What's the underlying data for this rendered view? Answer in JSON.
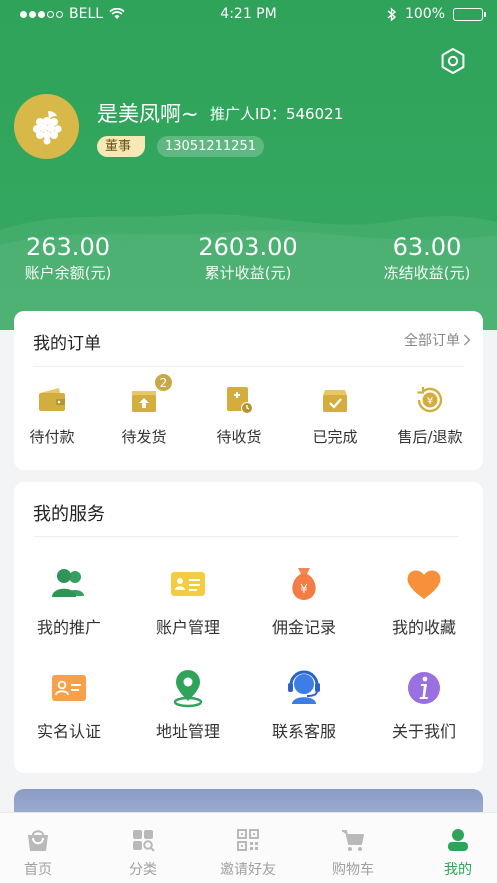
{
  "status_bar": {
    "carrier": "BELL",
    "time": "4:21 PM",
    "battery": "100%"
  },
  "profile": {
    "name": "是美凤啊~",
    "promoter_id": "推广人ID：546021",
    "role": "董事",
    "phone": "13051211251"
  },
  "stats": [
    {
      "value": "263.00",
      "label": "账户余额(元)"
    },
    {
      "value": "2603.00",
      "label": "累计收益(元)"
    },
    {
      "value": "63.00",
      "label": "冻结收益(元)"
    }
  ],
  "orders": {
    "title": "我的订单",
    "all_label": "全部订单",
    "items": [
      {
        "label": "待付款",
        "icon": "wallet-icon"
      },
      {
        "label": "待发货",
        "icon": "box-upload-icon",
        "badge": "2"
      },
      {
        "label": "待收货",
        "icon": "package-clock-icon"
      },
      {
        "label": "已完成",
        "icon": "box-check-icon"
      },
      {
        "label": "售后/退款",
        "icon": "refund-coin-icon"
      }
    ]
  },
  "services": {
    "title": "我的服务",
    "items": [
      {
        "label": "我的推广",
        "icon": "users-icon"
      },
      {
        "label": "账户管理",
        "icon": "id-card-icon"
      },
      {
        "label": "佣金记录",
        "icon": "money-bag-icon"
      },
      {
        "label": "我的收藏",
        "icon": "heart-icon"
      },
      {
        "label": "实名认证",
        "icon": "verify-card-icon"
      },
      {
        "label": "地址管理",
        "icon": "location-pin-icon"
      },
      {
        "label": "联系客服",
        "icon": "headset-icon"
      },
      {
        "label": "关于我们",
        "icon": "info-icon"
      }
    ]
  },
  "tabbar": {
    "items": [
      {
        "label": "首页",
        "icon": "home-bag-icon"
      },
      {
        "label": "分类",
        "icon": "category-icon"
      },
      {
        "label": "邀请好友",
        "icon": "qr-code-icon"
      },
      {
        "label": "购物车",
        "icon": "cart-icon"
      },
      {
        "label": "我的",
        "icon": "user-icon",
        "active": true
      }
    ]
  },
  "colors": {
    "brand_green": "#2fa35a",
    "gold": "#c9a84a",
    "inactive_tab": "#a0a0a0"
  }
}
